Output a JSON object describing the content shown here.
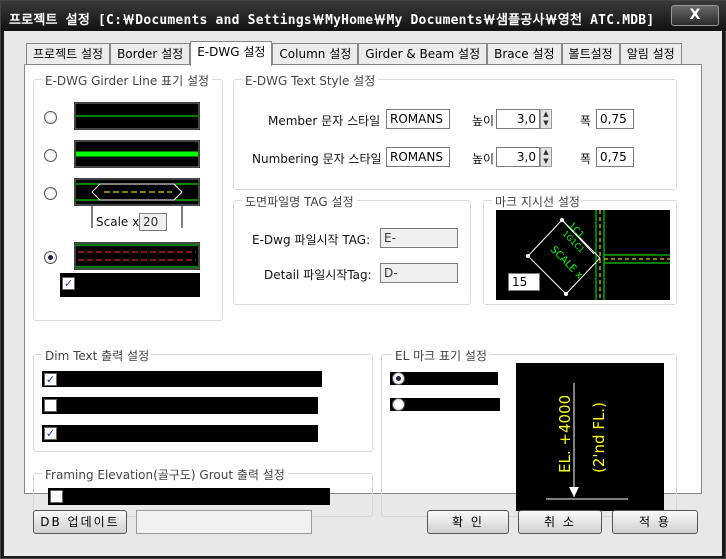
{
  "window": {
    "title": "프로젝트 설정  [C:￦Documents and Settings￦MyHome￦My Documents￦샘플공사￦영천 ATC.MDB]",
    "close_label": "X"
  },
  "tabs": [
    {
      "label": "프로젝트 설정"
    },
    {
      "label": "Border 설정"
    },
    {
      "label": "E-DWG 설정"
    },
    {
      "label": "Column 설정"
    },
    {
      "label": "Girder & Beam 설정"
    },
    {
      "label": "Brace 설정"
    },
    {
      "label": "볼트설정"
    },
    {
      "label": "알림 설정"
    }
  ],
  "girder_line": {
    "title": "E-DWG Girder Line 표기 설정",
    "scale_label": "Scale x",
    "scale_value": "20",
    "selected_option": 4,
    "check_checked": true
  },
  "text_style": {
    "title": "E-DWG Text Style 설정",
    "member_label": "Member 문자 스타일",
    "member_style": "ROMANS",
    "member_height_label": "높이",
    "member_height": "3,0",
    "member_width_label": "폭",
    "member_width": "0,75",
    "numbering_label": "Numbering 문자 스타일",
    "numbering_style": "ROMANS",
    "numbering_height_label": "높이",
    "numbering_height": "3,0",
    "numbering_width_label": "폭",
    "numbering_width": "0,75"
  },
  "tag": {
    "title": "도면파일명 TAG 설정",
    "edwg_label": "E-Dwg 파일시작 TAG:",
    "edwg_value": "E-",
    "detail_label": "Detail 파일시작Tag:",
    "detail_value": "D-"
  },
  "mark": {
    "title": "마크 지시선 설정",
    "value": "15",
    "text1": "1C1",
    "text2": "1G1C1",
    "text3": "SCALE x"
  },
  "dim_text": {
    "title": "Dim Text 출력 설정",
    "checks": [
      true,
      false,
      true
    ]
  },
  "el_mark": {
    "title": "EL 마크 표기 설정",
    "selected": 0,
    "preview_line1": "EL. +4000",
    "preview_line2": "(2'nd FL.)"
  },
  "framing": {
    "title": "Framing Elevation(골구도) Grout 출력 설정",
    "checked": false
  },
  "footer": {
    "db_update_label": "DB 업데이트",
    "ok_label": "확 인",
    "cancel_label": "취 소",
    "apply_label": "적 용"
  },
  "colors": {
    "accent_green": "#00ff00",
    "accent_yellow": "#ffff00",
    "accent_red": "#ff3030"
  }
}
